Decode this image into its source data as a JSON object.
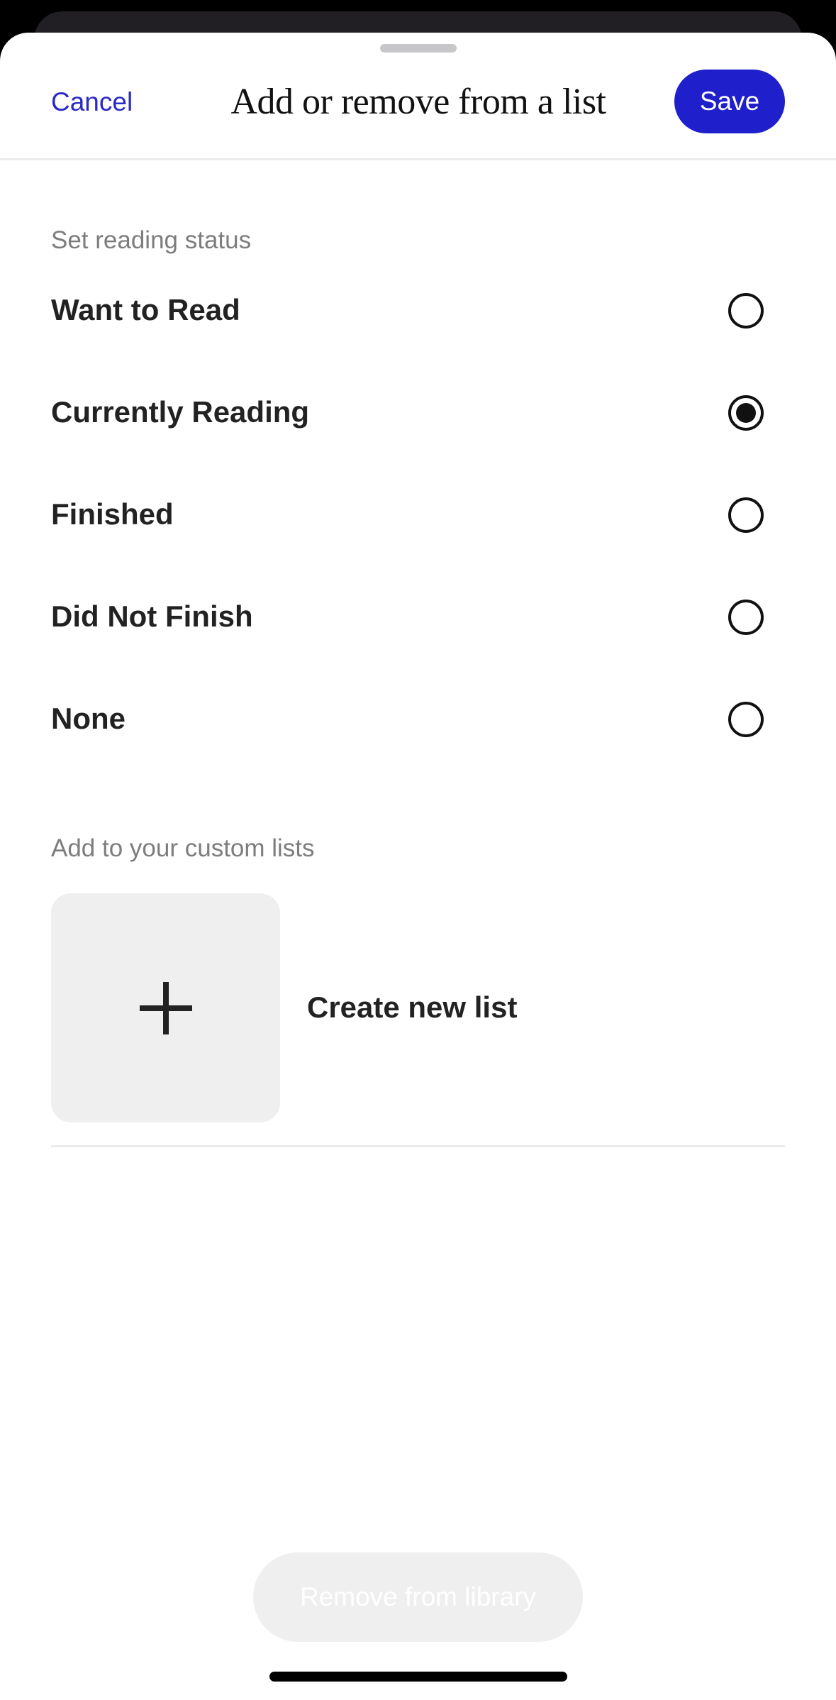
{
  "header": {
    "cancel_label": "Cancel",
    "title": "Add or remove from a list",
    "save_label": "Save"
  },
  "reading_status": {
    "section_label": "Set reading status",
    "options": [
      {
        "label": "Want to Read",
        "selected": false
      },
      {
        "label": "Currently Reading",
        "selected": true
      },
      {
        "label": "Finished",
        "selected": false
      },
      {
        "label": "Did Not Finish",
        "selected": false
      },
      {
        "label": "None",
        "selected": false
      }
    ]
  },
  "custom_lists": {
    "section_label": "Add to your custom lists",
    "create_label": "Create new list",
    "create_icon": "plus-icon"
  },
  "footer": {
    "remove_label": "Remove from library"
  },
  "colors": {
    "accent": "#1f1fcc",
    "link": "#2a2ac4",
    "tile": "#efefef"
  }
}
